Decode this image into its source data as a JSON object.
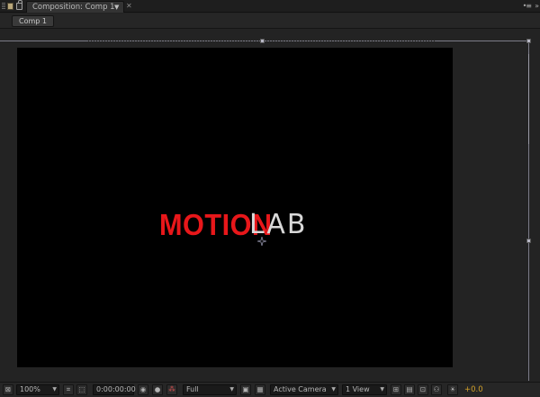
{
  "panel": {
    "tab_label": "Composition: Comp 1",
    "tab_dropdown": "▼",
    "close_glyph": "✕",
    "menu_glyph": "•≡",
    "chevron_glyph": "»"
  },
  "viewer": {
    "comp_button_label": "Comp 1"
  },
  "canvas": {
    "logo_part1": "MOTION",
    "logo_part2": "LAB",
    "logo_colors": {
      "motion": "#e8171a",
      "lab": "#d8d8d8"
    }
  },
  "controls": {
    "magnification": "100%",
    "dropdown_arrow": "▼",
    "timecode": "0:00:00:00",
    "resolution": "Full",
    "camera": "Active Camera",
    "views": "1 View",
    "exposure": "+0.0",
    "icons": {
      "region_of_interest": "⌗",
      "transparency_grid": "⬚",
      "snapshot": "◉",
      "show_snapshot": "●",
      "channel": "⁂",
      "fast_preview": "▣",
      "toggle_transparency": "▦",
      "grid_overlay": "⊞",
      "view_options": "▤",
      "lock_view": "⊡",
      "flowchart": "⚇",
      "reset_exposure": "☀",
      "bottom_left": "▣",
      "frame_display": "⊠"
    }
  }
}
